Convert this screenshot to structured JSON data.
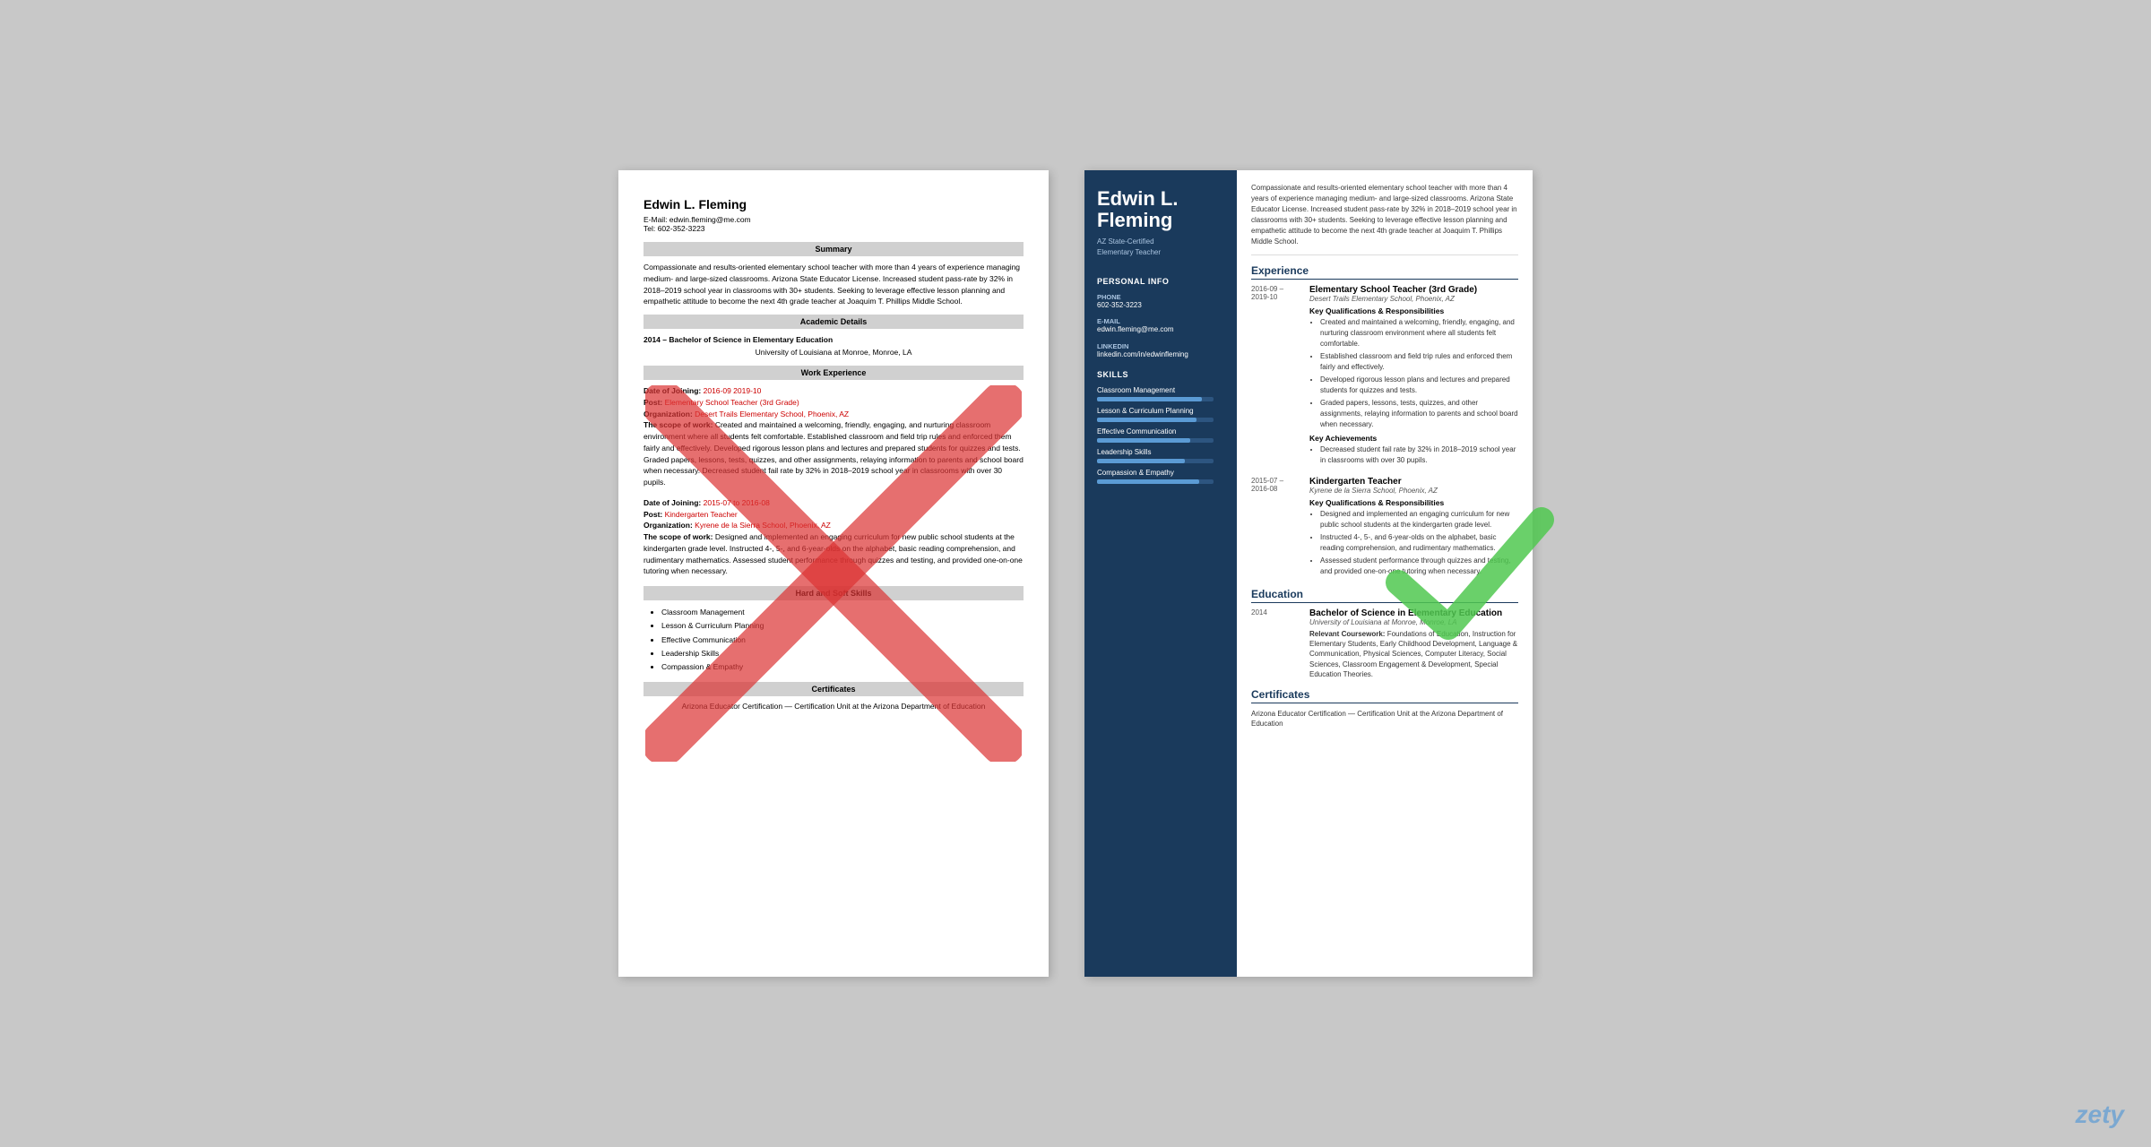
{
  "page": {
    "background_color": "#c8c8c8",
    "watermark": "zety"
  },
  "left_resume": {
    "name": "Edwin L. Fleming",
    "email": "E-Mail: edwin.fleming@me.com",
    "phone": "Tel: 602-352-3223",
    "sections": {
      "summary": {
        "header": "Summary",
        "text": "Compassionate and results-oriented elementary school teacher with more than 4 years of experience managing medium- and large-sized classrooms. Arizona State Educator License. Increased student pass-rate by 32% in 2018–2019 school year in classrooms with 30+ students. Seeking to leverage effective lesson planning and empathetic attitude to become the next 4th grade teacher at Joaquim T. Phillips Middle School."
      },
      "academic": {
        "header": "Academic Details",
        "year": "2014",
        "degree": "Bachelor of Science in Elementary Education",
        "university": "University of Louisiana at Monroe, Monroe, LA"
      },
      "work": {
        "header": "Work Experience",
        "entries": [
          {
            "date_label": "Date of Joining:",
            "date": "2016-09   2019-10",
            "post_label": "Post:",
            "post": "Elementary School Teacher (3rd Grade)",
            "org_label": "Organization:",
            "org": "Desert Trails Elementary School, Phoenix, AZ",
            "scope_label": "The scope of work:",
            "scope": "Created and maintained a welcoming, friendly, engaging, and nurturing classroom environment where all students felt comfortable. Established classroom and field trip rules and enforced them fairly and effectively. Developed rigorous lesson plans and lectures and prepared students for quizzes and tests. Graded papers, lessons, tests, quizzes, and other assignments, relaying information to parents and school board when necessary. Decreased student fail rate by 32% in 2018–2019 school year in classrooms with over 30 pupils."
          },
          {
            "date_label": "Date of Joining:",
            "date": "2015-07 to 2016-08",
            "post_label": "Post:",
            "post": "Kindergarten Teacher",
            "org_label": "Organization:",
            "org": "Kyrene de la Sierra School, Phoenix, AZ",
            "scope_label": "The scope of work:",
            "scope": "Designed and implemented an engaging curriculum for new public school students at the kindergarten grade level. Instructed 4-, 5-, and 6-year-olds on the alphabet, basic reading comprehension, and rudimentary mathematics. Assessed student performance through quizzes and testing, and provided one-on-one tutoring when necessary."
          }
        ]
      },
      "skills": {
        "header": "Hard and Soft Skills",
        "items": [
          "Classroom Management",
          "Lesson & Curriculum Planning",
          "Effective Communication",
          "Leadership Skills",
          "Compassion & Empathy"
        ]
      },
      "certificates": {
        "header": "Certificates",
        "text": "Arizona Educator Certification — Certification Unit at the Arizona Department of Education"
      }
    }
  },
  "right_resume": {
    "sidebar": {
      "first_name": "Edwin L.",
      "last_name": "Fleming",
      "tagline": "AZ State-Certified\nElementary Teacher",
      "personal_info": {
        "section_title": "Personal Info",
        "items": [
          {
            "label": "Phone",
            "value": "602-352-3223"
          },
          {
            "label": "E-mail",
            "value": "edwin.fleming@me.com"
          },
          {
            "label": "LinkedIn",
            "value": "linkedin.com/in/edwinfleming"
          }
        ]
      },
      "skills": {
        "section_title": "Skills",
        "items": [
          {
            "name": "Classroom Management",
            "percent": 90
          },
          {
            "name": "Lesson & Curriculum Planning",
            "percent": 85
          },
          {
            "name": "Effective Communication",
            "percent": 80
          },
          {
            "name": "Leadership Skills",
            "percent": 75
          },
          {
            "name": "Compassion & Empathy",
            "percent": 88
          }
        ]
      }
    },
    "main": {
      "summary": "Compassionate and results-oriented elementary school teacher with more than 4 years of experience managing medium- and large-sized classrooms. Arizona State Educator License. Increased student pass-rate by 32% in 2018–2019 school year in classrooms with 30+ students. Seeking to leverage effective lesson planning and empathetic attitude to become the next 4th grade teacher at Joaquim T. Phillips Middle School.",
      "experience_heading": "Experience",
      "experiences": [
        {
          "date": "2016-09 –\n2019-10",
          "title": "Elementary School Teacher (3rd Grade)",
          "org": "Desert Trails Elementary School, Phoenix, AZ",
          "qualifications_heading": "Key Qualifications & Responsibilities",
          "bullets": [
            "Created and maintained a welcoming, friendly, engaging, and nurturing classroom environment where all students felt comfortable.",
            "Established classroom and field trip rules and enforced them fairly and effectively.",
            "Developed rigorous lesson plans and lectures and prepared students for quizzes and tests.",
            "Graded papers, lessons, tests, quizzes, and other assignments, relaying information to parents and school board when necessary."
          ],
          "achievements_heading": "Key Achievements",
          "achievements": [
            "Decreased student fail rate by 32% in 2018–2019 school year in classrooms with over 30 pupils."
          ]
        },
        {
          "date": "2015-07 –\n2016-08",
          "title": "Kindergarten Teacher",
          "org": "Kyrene de la Sierra School, Phoenix, AZ",
          "qualifications_heading": "Key Qualifications & Responsibilities",
          "bullets": [
            "Designed and implemented an engaging curriculum for new public school students at the kindergarten grade level.",
            "Instructed 4-, 5-, and 6-year-olds on the alphabet, basic reading comprehension, and rudimentary mathematics.",
            "Assessed student performance through quizzes and testing, and provided one-on-one tutoring when necessary."
          ],
          "achievements_heading": null,
          "achievements": []
        }
      ],
      "education_heading": "Education",
      "education": [
        {
          "year": "2014",
          "degree": "Bachelor of Science in Elementary Education",
          "university": "University of Louisiana at Monroe, Monroe, LA",
          "coursework_label": "Relevant Coursework:",
          "coursework": "Foundations of Education, Instruction for Elementary Students, Early Childhood Development, Language & Communication, Physical Sciences, Computer Literacy, Social Sciences, Classroom Engagement & Development, Special Education Theories."
        }
      ],
      "certificates_heading": "Certificates",
      "certificates": "Arizona Educator Certification — Certification Unit at the Arizona Department of Education"
    }
  }
}
